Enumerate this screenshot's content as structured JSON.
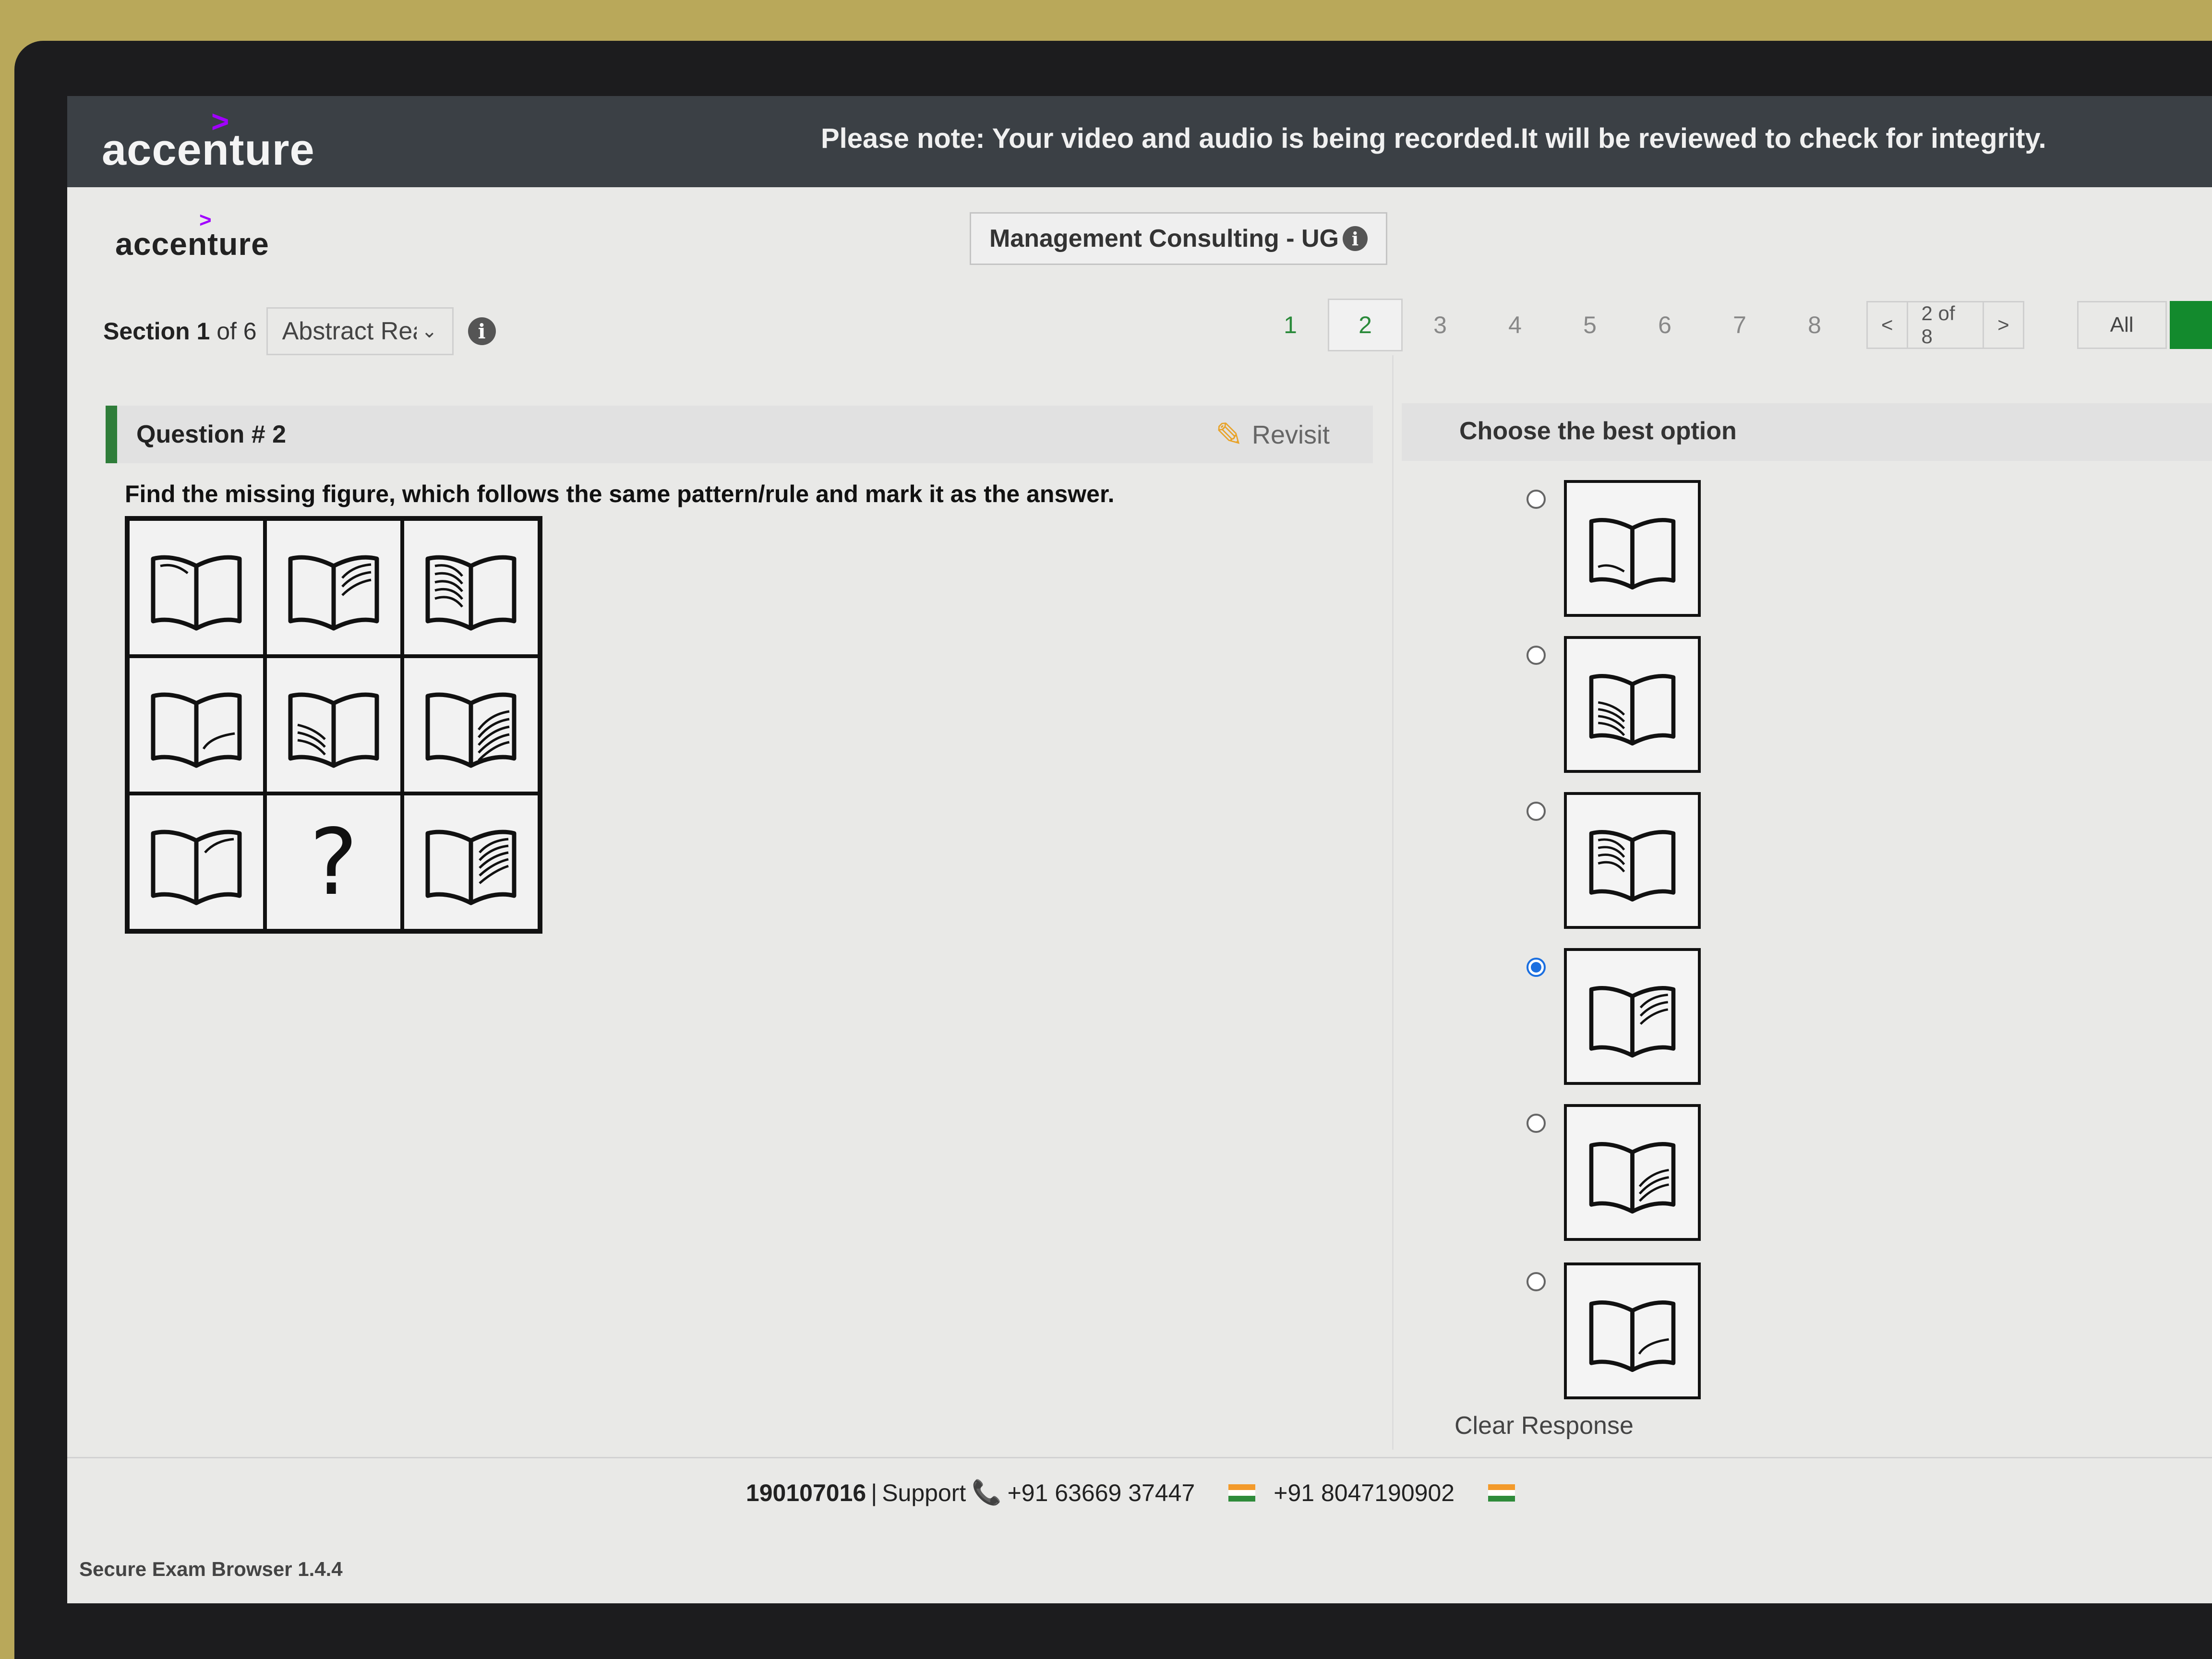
{
  "topbar": {
    "brand": "accenture",
    "notice": "Please note: Your video and audio is being recorded.It will be reviewed to check for integrity."
  },
  "header": {
    "brand": "accenture",
    "exam_title": "Management Consulting - UG",
    "info_icon": "i"
  },
  "section": {
    "label_bold": "Section 1",
    "label_rest": " of 6",
    "dropdown_value": "Abstract Rea",
    "chevron": "⌄",
    "info_icon": "i"
  },
  "question_nav": {
    "numbers": [
      "1",
      "2",
      "3",
      "4",
      "5",
      "6",
      "7",
      "8"
    ],
    "current_index": 1,
    "answered": [
      0,
      1
    ],
    "prev": "<",
    "position": "2 of 8",
    "next": ">",
    "all_button": "All"
  },
  "question": {
    "title": "Question # 2",
    "revisit_label": "Revisit",
    "revisit_icon": "✎",
    "text": "Find the missing figure, which follows the same pattern/rule and mark it as the answer.",
    "missing_mark": "?"
  },
  "options_panel": {
    "title": "Choose the best option",
    "selected_index": 3,
    "clear_response": "Clear Response"
  },
  "footer": {
    "candidate_id": "190107016",
    "support_label": "Support",
    "phone_icon": "📞",
    "phone1": "+91 63669 37447",
    "phone2": "+91 8047190902",
    "flag_colors": [
      "#f39a2a",
      "#ffffff",
      "#2e8b3a"
    ]
  },
  "version": "Secure Exam Browser 1.4.4"
}
